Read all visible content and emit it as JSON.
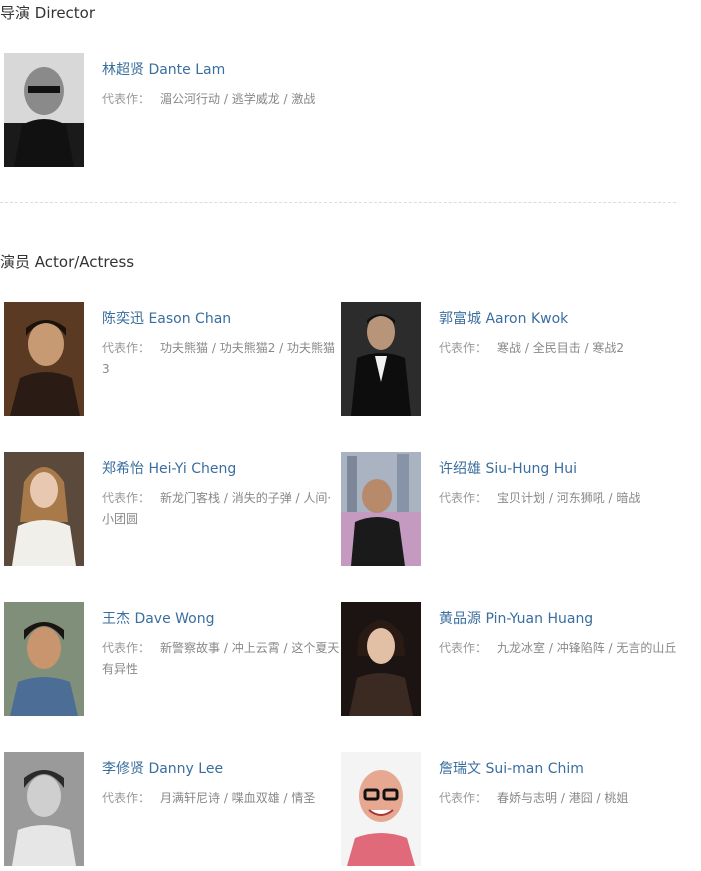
{
  "director": {
    "section_title": "导演 Director",
    "people": [
      {
        "name": "林超贤 Dante Lam",
        "works_label": "代表作：",
        "works": "湄公河行动 / 逃学威龙 / 激战",
        "photo_icon": "person-photo-icon"
      }
    ]
  },
  "actors": {
    "section_title": "演员 Actor/Actress",
    "people": [
      {
        "name": "陈奕迅 Eason Chan",
        "works_label": "代表作：",
        "works": "功夫熊猫 / 功夫熊猫2 / 功夫熊猫3"
      },
      {
        "name": "郭富城 Aaron Kwok",
        "works_label": "代表作：",
        "works": "寒战 / 全民目击 / 寒战2"
      },
      {
        "name": "郑希怡 Hei-Yi Cheng",
        "works_label": "代表作：",
        "works": "新龙门客栈 / 消失的子弹 / 人间·小团圆"
      },
      {
        "name": "许绍雄 Siu-Hung Hui",
        "works_label": "代表作：",
        "works": "宝贝计划 / 河东狮吼 / 暗战"
      },
      {
        "name": "王杰 Dave Wong",
        "works_label": "代表作：",
        "works": "新警察故事 / 冲上云霄 / 这个夏天有异性"
      },
      {
        "name": "黄品源 Pin-Yuan Huang",
        "works_label": "代表作：",
        "works": "九龙冰室 / 冲锋陷阵 / 无言的山丘"
      },
      {
        "name": "李修贤 Danny Lee",
        "works_label": "代表作：",
        "works": "月满轩尼诗 / 喋血双雄 / 情圣"
      },
      {
        "name": "詹瑞文 Sui-man Chim",
        "works_label": "代表作：",
        "works": "春娇与志明 / 港囧 / 桃姐"
      }
    ]
  }
}
